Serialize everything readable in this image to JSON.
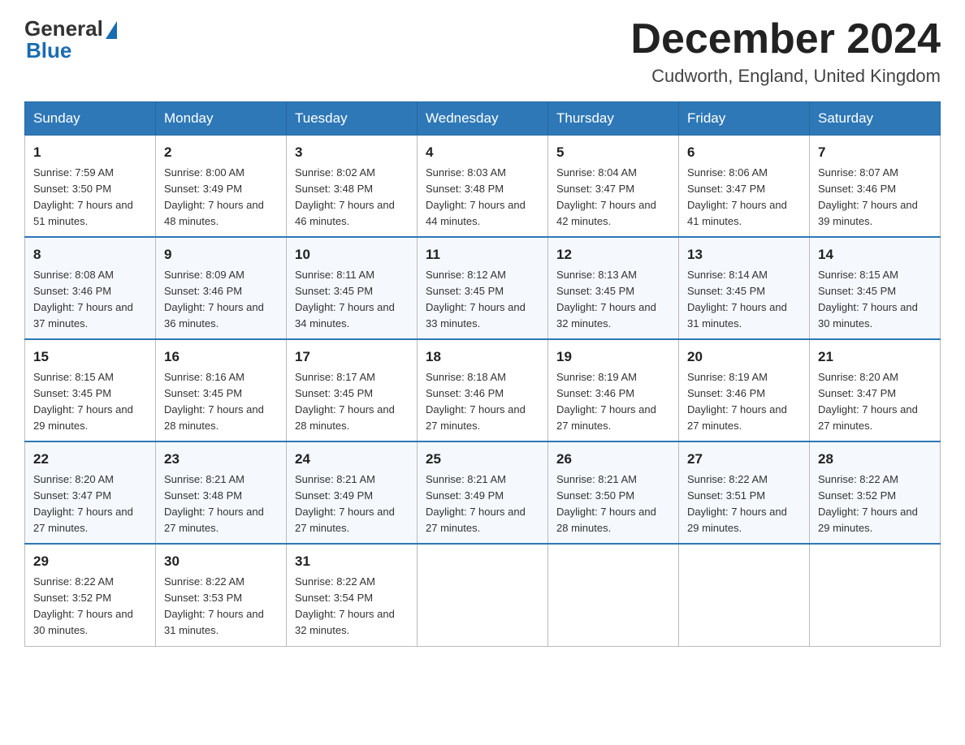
{
  "header": {
    "logo_general": "General",
    "logo_blue": "Blue",
    "month_title": "December 2024",
    "location": "Cudworth, England, United Kingdom"
  },
  "days_of_week": [
    "Sunday",
    "Monday",
    "Tuesday",
    "Wednesday",
    "Thursday",
    "Friday",
    "Saturday"
  ],
  "weeks": [
    [
      {
        "day": "1",
        "sunrise": "7:59 AM",
        "sunset": "3:50 PM",
        "daylight": "7 hours and 51 minutes."
      },
      {
        "day": "2",
        "sunrise": "8:00 AM",
        "sunset": "3:49 PM",
        "daylight": "7 hours and 48 minutes."
      },
      {
        "day": "3",
        "sunrise": "8:02 AM",
        "sunset": "3:48 PM",
        "daylight": "7 hours and 46 minutes."
      },
      {
        "day": "4",
        "sunrise": "8:03 AM",
        "sunset": "3:48 PM",
        "daylight": "7 hours and 44 minutes."
      },
      {
        "day": "5",
        "sunrise": "8:04 AM",
        "sunset": "3:47 PM",
        "daylight": "7 hours and 42 minutes."
      },
      {
        "day": "6",
        "sunrise": "8:06 AM",
        "sunset": "3:47 PM",
        "daylight": "7 hours and 41 minutes."
      },
      {
        "day": "7",
        "sunrise": "8:07 AM",
        "sunset": "3:46 PM",
        "daylight": "7 hours and 39 minutes."
      }
    ],
    [
      {
        "day": "8",
        "sunrise": "8:08 AM",
        "sunset": "3:46 PM",
        "daylight": "7 hours and 37 minutes."
      },
      {
        "day": "9",
        "sunrise": "8:09 AM",
        "sunset": "3:46 PM",
        "daylight": "7 hours and 36 minutes."
      },
      {
        "day": "10",
        "sunrise": "8:11 AM",
        "sunset": "3:45 PM",
        "daylight": "7 hours and 34 minutes."
      },
      {
        "day": "11",
        "sunrise": "8:12 AM",
        "sunset": "3:45 PM",
        "daylight": "7 hours and 33 minutes."
      },
      {
        "day": "12",
        "sunrise": "8:13 AM",
        "sunset": "3:45 PM",
        "daylight": "7 hours and 32 minutes."
      },
      {
        "day": "13",
        "sunrise": "8:14 AM",
        "sunset": "3:45 PM",
        "daylight": "7 hours and 31 minutes."
      },
      {
        "day": "14",
        "sunrise": "8:15 AM",
        "sunset": "3:45 PM",
        "daylight": "7 hours and 30 minutes."
      }
    ],
    [
      {
        "day": "15",
        "sunrise": "8:15 AM",
        "sunset": "3:45 PM",
        "daylight": "7 hours and 29 minutes."
      },
      {
        "day": "16",
        "sunrise": "8:16 AM",
        "sunset": "3:45 PM",
        "daylight": "7 hours and 28 minutes."
      },
      {
        "day": "17",
        "sunrise": "8:17 AM",
        "sunset": "3:45 PM",
        "daylight": "7 hours and 28 minutes."
      },
      {
        "day": "18",
        "sunrise": "8:18 AM",
        "sunset": "3:46 PM",
        "daylight": "7 hours and 27 minutes."
      },
      {
        "day": "19",
        "sunrise": "8:19 AM",
        "sunset": "3:46 PM",
        "daylight": "7 hours and 27 minutes."
      },
      {
        "day": "20",
        "sunrise": "8:19 AM",
        "sunset": "3:46 PM",
        "daylight": "7 hours and 27 minutes."
      },
      {
        "day": "21",
        "sunrise": "8:20 AM",
        "sunset": "3:47 PM",
        "daylight": "7 hours and 27 minutes."
      }
    ],
    [
      {
        "day": "22",
        "sunrise": "8:20 AM",
        "sunset": "3:47 PM",
        "daylight": "7 hours and 27 minutes."
      },
      {
        "day": "23",
        "sunrise": "8:21 AM",
        "sunset": "3:48 PM",
        "daylight": "7 hours and 27 minutes."
      },
      {
        "day": "24",
        "sunrise": "8:21 AM",
        "sunset": "3:49 PM",
        "daylight": "7 hours and 27 minutes."
      },
      {
        "day": "25",
        "sunrise": "8:21 AM",
        "sunset": "3:49 PM",
        "daylight": "7 hours and 27 minutes."
      },
      {
        "day": "26",
        "sunrise": "8:21 AM",
        "sunset": "3:50 PM",
        "daylight": "7 hours and 28 minutes."
      },
      {
        "day": "27",
        "sunrise": "8:22 AM",
        "sunset": "3:51 PM",
        "daylight": "7 hours and 29 minutes."
      },
      {
        "day": "28",
        "sunrise": "8:22 AM",
        "sunset": "3:52 PM",
        "daylight": "7 hours and 29 minutes."
      }
    ],
    [
      {
        "day": "29",
        "sunrise": "8:22 AM",
        "sunset": "3:52 PM",
        "daylight": "7 hours and 30 minutes."
      },
      {
        "day": "30",
        "sunrise": "8:22 AM",
        "sunset": "3:53 PM",
        "daylight": "7 hours and 31 minutes."
      },
      {
        "day": "31",
        "sunrise": "8:22 AM",
        "sunset": "3:54 PM",
        "daylight": "7 hours and 32 minutes."
      },
      null,
      null,
      null,
      null
    ]
  ]
}
